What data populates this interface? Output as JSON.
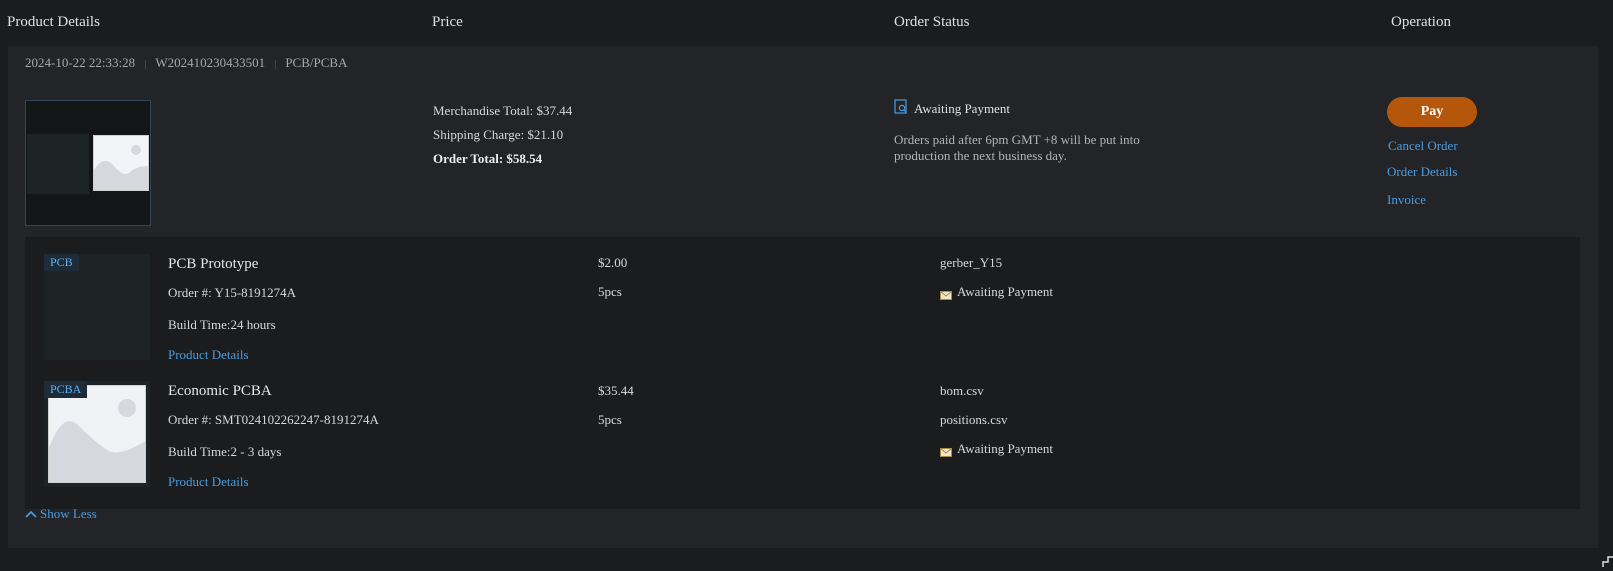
{
  "header": {
    "product_details": "Product Details",
    "price": "Price",
    "order_status": "Order Status",
    "operation": "Operation"
  },
  "order": {
    "datetime": "2024-10-22 22:33:28",
    "order_no": "W202410230433501",
    "category": "PCB/PCBA",
    "merchandise_total": "Merchandise Total: $37.44",
    "shipping_charge": "Shipping Charge: $21.10",
    "order_total": "Order Total: $58.54",
    "status": "Awaiting Payment",
    "status_note": "Orders paid after 6pm GMT +8 will be put into production the next business day.",
    "pay_label": "Pay",
    "cancel_label": "Cancel Order",
    "details_label": "Order Details",
    "invoice_label": "Invoice"
  },
  "items": [
    {
      "tag": "PCB",
      "name": "PCB Prototype",
      "order_no": "Order #: Y15-8191274A",
      "build_time": "Build Time:24 hours",
      "link": "Product Details",
      "price": "$2.00",
      "qty": "5pcs",
      "files": [
        "gerber_Y15"
      ],
      "status": "Awaiting Payment"
    },
    {
      "tag": "PCBA",
      "name": "Economic PCBA",
      "order_no": "Order #: SMT024102262247-8191274A",
      "build_time": "Build Time:2 - 3 days",
      "link": "Product Details",
      "price": "$35.44",
      "qty": "5pcs",
      "files": [
        "bom.csv",
        "positions.csv"
      ],
      "status": "Awaiting Payment"
    }
  ],
  "show_less": "Show Less",
  "colors": {
    "background": "#1b1c1e",
    "card": "#232427",
    "accent_link": "#4a9de0",
    "pay_button": "#b5570a"
  }
}
